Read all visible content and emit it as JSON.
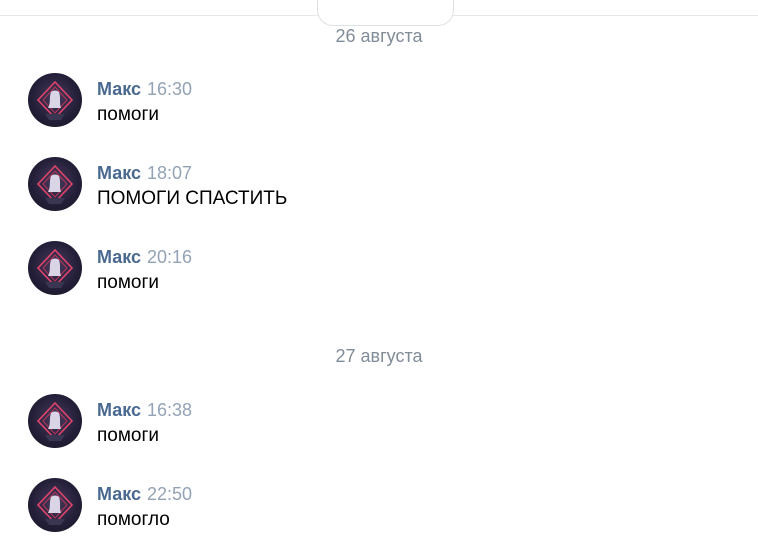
{
  "floating_date": "",
  "groups": [
    {
      "date": "26 августа",
      "messages": [
        {
          "author": "Макс",
          "time": "16:30",
          "text": "помоги"
        },
        {
          "author": "Макс",
          "time": "18:07",
          "text": "ПОМОГИ СПАСТИТЬ"
        },
        {
          "author": "Макс",
          "time": "20:16",
          "text": "помоги"
        }
      ]
    },
    {
      "date": "27 августа",
      "messages": [
        {
          "author": "Макс",
          "time": "16:38",
          "text": "помоги"
        },
        {
          "author": "Макс",
          "time": "22:50",
          "text": "помогло"
        }
      ]
    }
  ],
  "colors": {
    "author": "#4a6991",
    "time": "#93a3b5",
    "date": "#818c99",
    "avatar_accent": "#e0446a"
  },
  "icons": {
    "avatar": "user-avatar-icon"
  }
}
